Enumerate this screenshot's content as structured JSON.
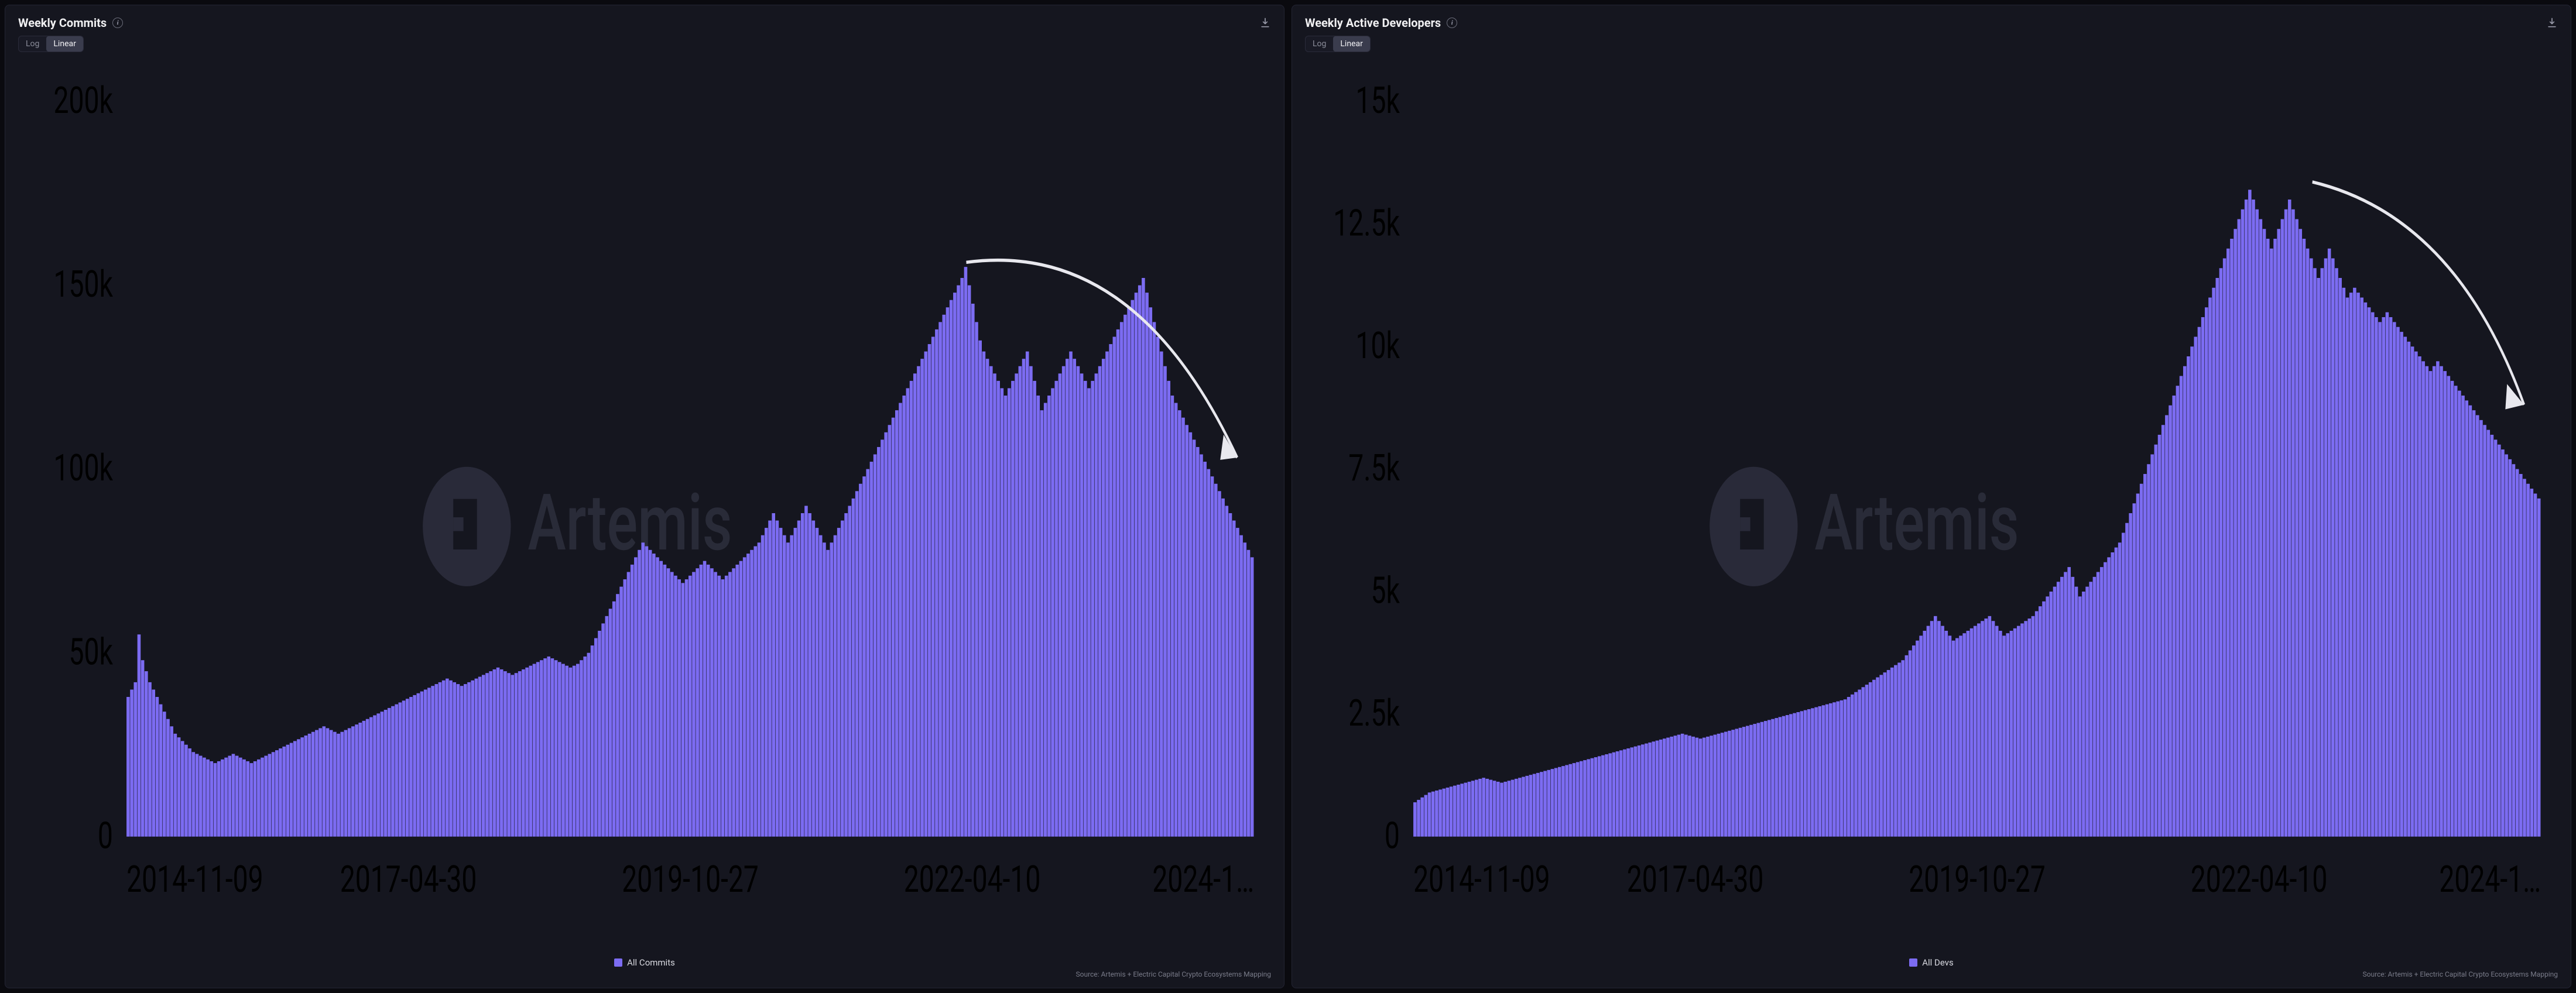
{
  "watermark": "Artemis",
  "source_line": "Source: Artemis + Electric Capital Crypto Ecosystems Mapping",
  "scale_options": [
    "Log",
    "Linear"
  ],
  "scale_active": "Linear",
  "x_labels": [
    "2014-11-09",
    "2017-04-30",
    "2019-10-27",
    "2022-04-10",
    "2024-1…"
  ],
  "charts": {
    "commits": {
      "title": "Weekly Commits",
      "legend": "All Commits",
      "y_ticks": [
        "0",
        "50k",
        "100k",
        "150k",
        "200k"
      ]
    },
    "devs": {
      "title": "Weekly Active Developers",
      "legend": "All Devs",
      "y_ticks": [
        "0",
        "2.5k",
        "5k",
        "7.5k",
        "10k",
        "12.5k",
        "15k"
      ]
    }
  },
  "chart_data": [
    {
      "type": "bar",
      "title": "Weekly Commits",
      "xlabel": "",
      "ylabel": "",
      "ylim": [
        0,
        200000
      ],
      "series_name": "All Commits",
      "x_start": "2014-11-09",
      "x_end": "2024-10",
      "x_tick_labels": [
        "2014-11-09",
        "2017-04-30",
        "2019-10-27",
        "2022-04-10",
        "2024-1…"
      ],
      "values": [
        38000,
        40000,
        42000,
        55000,
        48000,
        45000,
        42000,
        40000,
        38000,
        36000,
        34000,
        32000,
        30000,
        28000,
        27000,
        26000,
        25000,
        24000,
        23000,
        22500,
        22000,
        21500,
        21000,
        20500,
        20000,
        20500,
        21000,
        21500,
        22000,
        22500,
        22000,
        21500,
        21000,
        20500,
        20000,
        20500,
        21000,
        21500,
        22000,
        22500,
        23000,
        23500,
        24000,
        24500,
        25000,
        25500,
        26000,
        26500,
        27000,
        27500,
        28000,
        28500,
        29000,
        29500,
        30000,
        29500,
        29000,
        28500,
        28000,
        28500,
        29000,
        29500,
        30000,
        30500,
        31000,
        31500,
        32000,
        32500,
        33000,
        33500,
        34000,
        34500,
        35000,
        35500,
        36000,
        36500,
        37000,
        37500,
        38000,
        38500,
        39000,
        39500,
        40000,
        40500,
        41000,
        41500,
        42000,
        42500,
        43000,
        42500,
        42000,
        41500,
        41000,
        41500,
        42000,
        42500,
        43000,
        43500,
        44000,
        44500,
        45000,
        45500,
        46000,
        45500,
        45000,
        44500,
        44000,
        44500,
        45000,
        45500,
        46000,
        46500,
        47000,
        47500,
        48000,
        48500,
        49000,
        48500,
        48000,
        47500,
        47000,
        46500,
        46000,
        46500,
        47000,
        48000,
        49000,
        50000,
        52000,
        54000,
        56000,
        58000,
        60000,
        62000,
        64000,
        66000,
        68000,
        70000,
        72000,
        74000,
        76000,
        78000,
        80000,
        79000,
        78000,
        77000,
        76000,
        75000,
        74000,
        73000,
        72000,
        71000,
        70000,
        69000,
        70000,
        71000,
        72000,
        73000,
        74000,
        75000,
        74000,
        73000,
        72000,
        71000,
        70000,
        71000,
        72000,
        73000,
        74000,
        75000,
        76000,
        77000,
        78000,
        79000,
        80000,
        82000,
        84000,
        86000,
        88000,
        86000,
        84000,
        82000,
        80000,
        82000,
        84000,
        86000,
        88000,
        90000,
        88000,
        86000,
        84000,
        82000,
        80000,
        78000,
        80000,
        82000,
        84000,
        86000,
        88000,
        90000,
        92000,
        94000,
        96000,
        98000,
        100000,
        102000,
        104000,
        106000,
        108000,
        110000,
        112000,
        114000,
        116000,
        118000,
        120000,
        122000,
        124000,
        126000,
        128000,
        130000,
        132000,
        134000,
        136000,
        138000,
        140000,
        142000,
        144000,
        146000,
        148000,
        150000,
        152000,
        155000,
        150000,
        145000,
        140000,
        135000,
        132000,
        130000,
        128000,
        126000,
        124000,
        122000,
        120000,
        122000,
        124000,
        126000,
        128000,
        130000,
        132000,
        128000,
        124000,
        120000,
        116000,
        118000,
        120000,
        122000,
        124000,
        126000,
        128000,
        130000,
        132000,
        130000,
        128000,
        126000,
        124000,
        122000,
        124000,
        126000,
        128000,
        130000,
        132000,
        134000,
        136000,
        138000,
        140000,
        142000,
        144000,
        146000,
        148000,
        150000,
        152000,
        148000,
        144000,
        140000,
        136000,
        132000,
        128000,
        124000,
        120000,
        118000,
        116000,
        114000,
        112000,
        110000,
        108000,
        106000,
        104000,
        102000,
        100000,
        98000,
        96000,
        94000,
        92000,
        90000,
        88000,
        86000,
        84000,
        82000,
        80000,
        78000,
        76000
      ]
    },
    {
      "type": "bar",
      "title": "Weekly Active Developers",
      "xlabel": "",
      "ylabel": "",
      "ylim": [
        0,
        15000
      ],
      "series_name": "All Devs",
      "x_start": "2014-11-09",
      "x_end": "2024-10",
      "x_tick_labels": [
        "2014-11-09",
        "2017-04-30",
        "2019-10-27",
        "2022-04-10",
        "2024-1…"
      ],
      "values": [
        700,
        750,
        800,
        850,
        900,
        920,
        940,
        960,
        980,
        1000,
        1020,
        1040,
        1060,
        1080,
        1100,
        1120,
        1140,
        1160,
        1180,
        1200,
        1180,
        1160,
        1140,
        1120,
        1100,
        1120,
        1140,
        1160,
        1180,
        1200,
        1220,
        1240,
        1260,
        1280,
        1300,
        1320,
        1340,
        1360,
        1380,
        1400,
        1420,
        1440,
        1460,
        1480,
        1500,
        1520,
        1540,
        1560,
        1580,
        1600,
        1620,
        1640,
        1660,
        1680,
        1700,
        1720,
        1740,
        1760,
        1780,
        1800,
        1820,
        1840,
        1860,
        1880,
        1900,
        1920,
        1940,
        1960,
        1980,
        2000,
        2020,
        2040,
        2060,
        2080,
        2100,
        2080,
        2060,
        2040,
        2020,
        2000,
        2020,
        2040,
        2060,
        2080,
        2100,
        2120,
        2140,
        2160,
        2180,
        2200,
        2220,
        2240,
        2260,
        2280,
        2300,
        2320,
        2340,
        2360,
        2380,
        2400,
        2420,
        2440,
        2460,
        2480,
        2500,
        2520,
        2540,
        2560,
        2580,
        2600,
        2620,
        2640,
        2660,
        2680,
        2700,
        2720,
        2740,
        2760,
        2780,
        2800,
        2850,
        2900,
        2950,
        3000,
        3050,
        3100,
        3150,
        3200,
        3250,
        3300,
        3350,
        3400,
        3450,
        3500,
        3550,
        3600,
        3700,
        3800,
        3900,
        4000,
        4100,
        4200,
        4300,
        4400,
        4500,
        4400,
        4300,
        4200,
        4100,
        4000,
        4050,
        4100,
        4150,
        4200,
        4250,
        4300,
        4350,
        4400,
        4450,
        4500,
        4400,
        4300,
        4200,
        4100,
        4150,
        4200,
        4250,
        4300,
        4350,
        4400,
        4450,
        4500,
        4600,
        4700,
        4800,
        4900,
        5000,
        5100,
        5200,
        5300,
        5400,
        5500,
        5300,
        5100,
        4900,
        5000,
        5100,
        5200,
        5300,
        5400,
        5500,
        5600,
        5700,
        5800,
        5900,
        6000,
        6200,
        6400,
        6600,
        6800,
        7000,
        7200,
        7400,
        7600,
        7800,
        8000,
        8200,
        8400,
        8600,
        8800,
        9000,
        9200,
        9400,
        9600,
        9800,
        10000,
        10200,
        10400,
        10600,
        10800,
        11000,
        11200,
        11400,
        11600,
        11800,
        12000,
        12200,
        12400,
        12600,
        12800,
        13000,
        13200,
        13000,
        12800,
        12600,
        12400,
        12200,
        12000,
        12200,
        12400,
        12600,
        12800,
        13000,
        12800,
        12600,
        12400,
        12200,
        12000,
        11800,
        11600,
        11400,
        11600,
        11800,
        12000,
        11800,
        11600,
        11400,
        11200,
        11000,
        11100,
        11200,
        11100,
        11000,
        10900,
        10800,
        10700,
        10600,
        10500,
        10600,
        10700,
        10600,
        10500,
        10400,
        10300,
        10200,
        10100,
        10000,
        9900,
        9800,
        9700,
        9600,
        9500,
        9600,
        9700,
        9600,
        9500,
        9400,
        9300,
        9200,
        9100,
        9000,
        8900,
        8800,
        8700,
        8600,
        8500,
        8400,
        8300,
        8200,
        8100,
        8000,
        7900,
        7800,
        7700,
        7600,
        7500,
        7400,
        7300,
        7200,
        7100,
        7000,
        6900
      ]
    }
  ]
}
